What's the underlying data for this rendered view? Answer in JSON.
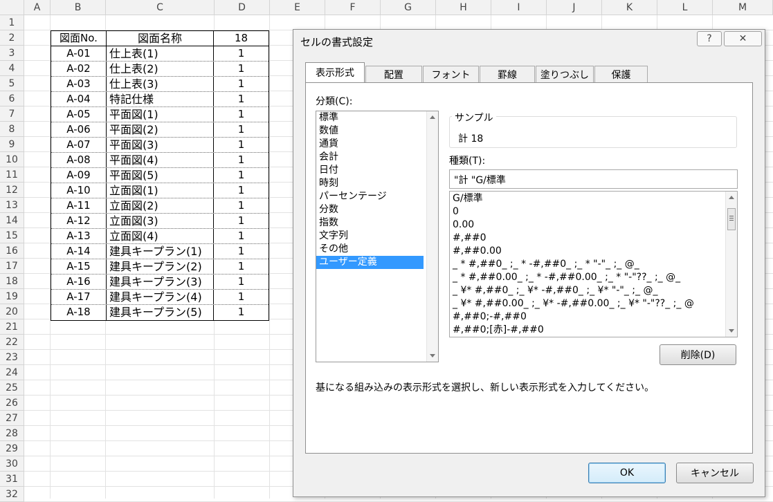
{
  "columns": [
    "A",
    "B",
    "C",
    "D",
    "E",
    "F",
    "G",
    "H",
    "I",
    "J",
    "K",
    "L",
    "M"
  ],
  "rows": [
    "1",
    "2",
    "3",
    "4",
    "5",
    "6",
    "7",
    "8",
    "9",
    "10",
    "11",
    "12",
    "13",
    "14",
    "15",
    "16",
    "17",
    "18",
    "19",
    "20",
    "21",
    "22",
    "23",
    "24",
    "25",
    "26",
    "27",
    "28",
    "29",
    "30",
    "31",
    "32"
  ],
  "table": {
    "header": {
      "no": "図面No.",
      "name": "図面名称",
      "count": "18"
    },
    "rows": [
      {
        "no": "A-01",
        "name": "仕上表(1)",
        "count": "1"
      },
      {
        "no": "A-02",
        "name": "仕上表(2)",
        "count": "1"
      },
      {
        "no": "A-03",
        "name": "仕上表(3)",
        "count": "1"
      },
      {
        "no": "A-04",
        "name": "特記仕様",
        "count": "1"
      },
      {
        "no": "A-05",
        "name": "平面図(1)",
        "count": "1"
      },
      {
        "no": "A-06",
        "name": "平面図(2)",
        "count": "1"
      },
      {
        "no": "A-07",
        "name": "平面図(3)",
        "count": "1"
      },
      {
        "no": "A-08",
        "name": "平面図(4)",
        "count": "1"
      },
      {
        "no": "A-09",
        "name": "平面図(5)",
        "count": "1"
      },
      {
        "no": "A-10",
        "name": "立面図(1)",
        "count": "1"
      },
      {
        "no": "A-11",
        "name": "立面図(2)",
        "count": "1"
      },
      {
        "no": "A-12",
        "name": "立面図(3)",
        "count": "1"
      },
      {
        "no": "A-13",
        "name": "立面図(4)",
        "count": "1"
      },
      {
        "no": "A-14",
        "name": "建具キープラン(1)",
        "count": "1"
      },
      {
        "no": "A-15",
        "name": "建具キープラン(2)",
        "count": "1"
      },
      {
        "no": "A-16",
        "name": "建具キープラン(3)",
        "count": "1"
      },
      {
        "no": "A-17",
        "name": "建具キープラン(4)",
        "count": "1"
      },
      {
        "no": "A-18",
        "name": "建具キープラン(5)",
        "count": "1"
      }
    ]
  },
  "dialog": {
    "title": "セルの書式設定",
    "help": "?",
    "close": "✕",
    "tabs": [
      "表示形式",
      "配置",
      "フォント",
      "罫線",
      "塗りつぶし",
      "保護"
    ],
    "category_label": "分類(C):",
    "categories": [
      "標準",
      "数値",
      "通貨",
      "会計",
      "日付",
      "時刻",
      "パーセンテージ",
      "分数",
      "指数",
      "文字列",
      "その他",
      "ユーザー定義"
    ],
    "selected_category": "ユーザー定義",
    "sample_label": "サンプル",
    "sample_value": "計 18",
    "type_label": "種類(T):",
    "type_value": "\"計 \"G/標準",
    "formats": [
      "G/標準",
      "0",
      "0.00",
      "#,##0",
      "#,##0.00",
      "_ * #,##0_ ;_ * -#,##0_ ;_ * \"-\"_ ;_ @_",
      "_ * #,##0.00_ ;_ * -#,##0.00_ ;_ * \"-\"??_ ;_ @_",
      "_ ¥* #,##0_ ;_ ¥* -#,##0_ ;_ ¥* \"-\"_ ;_ @_",
      "_ ¥* #,##0.00_ ;_ ¥* -#,##0.00_ ;_ ¥* \"-\"??_ ;_ @",
      "#,##0;-#,##0",
      "#,##0;[赤]-#,##0"
    ],
    "delete_button": "削除(D)",
    "description": "基になる組み込みの表示形式を選択し、新しい表示形式を入力してください。",
    "ok_button": "OK",
    "cancel_button": "キャンセル"
  },
  "colors": {
    "selection": "#3399ff",
    "header_bg": "#f2f2f2",
    "dialog_bg": "#f0f0f0"
  }
}
